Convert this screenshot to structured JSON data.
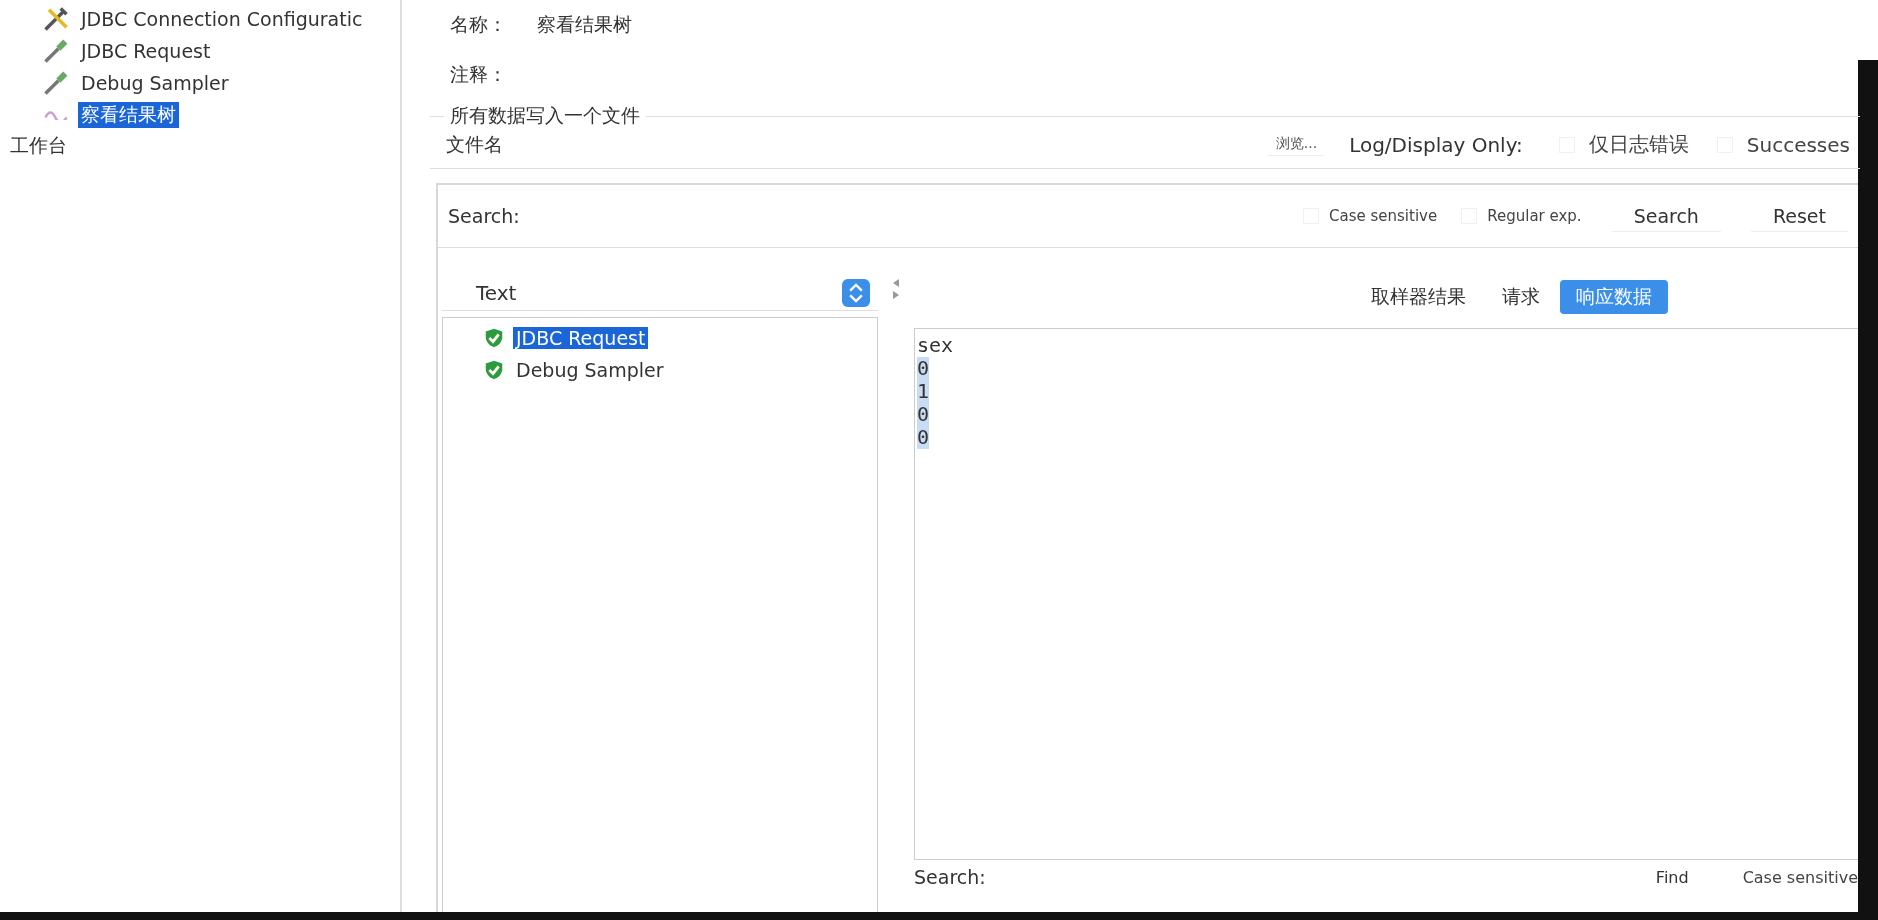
{
  "sidebar": {
    "tree_items": [
      {
        "label": "JDBC Connection Configuratic",
        "kind": "config",
        "selected": false
      },
      {
        "label": "JDBC Request",
        "kind": "sampler",
        "selected": false
      },
      {
        "label": "Debug Sampler",
        "kind": "sampler",
        "selected": false
      },
      {
        "label": "察看结果树",
        "kind": "listener",
        "selected": true
      }
    ],
    "workbench": {
      "label": "工作台"
    }
  },
  "form": {
    "name_label": "名称：",
    "name_value": "察看结果树",
    "comment_label": "注释：",
    "file_group": {
      "title": "所有数据写入一个文件",
      "file_label": "文件名",
      "browse": "浏览...",
      "log_label": "Log/Display Only:",
      "options": [
        {
          "label": "仅日志错误",
          "checked": false
        },
        {
          "label": "Successes",
          "checked": false
        }
      ]
    }
  },
  "search": {
    "label": "Search:",
    "options": [
      {
        "label": "Case sensitive",
        "checked": false
      },
      {
        "label": "Regular exp.",
        "checked": false
      }
    ],
    "buttons": [
      "Search",
      "Reset"
    ]
  },
  "results": {
    "renderer": "Text",
    "samples": [
      {
        "label": "JDBC Request",
        "kind": "success",
        "selected": true
      },
      {
        "label": "Debug Sampler",
        "kind": "success",
        "selected": false
      }
    ],
    "tabs": [
      {
        "label": "取样器结果",
        "selected": false
      },
      {
        "label": "请求",
        "selected": false
      },
      {
        "label": "响应数据",
        "selected": true
      }
    ],
    "response_lines": [
      {
        "text": "sex",
        "selected": false
      },
      {
        "text": "0",
        "selected": true
      },
      {
        "text": "1",
        "selected": true
      },
      {
        "text": "0",
        "selected": true
      },
      {
        "text": "0",
        "selected": true
      }
    ],
    "bottom_search": {
      "label": "Search:",
      "find": "Find",
      "option": "Case sensitive"
    }
  }
}
